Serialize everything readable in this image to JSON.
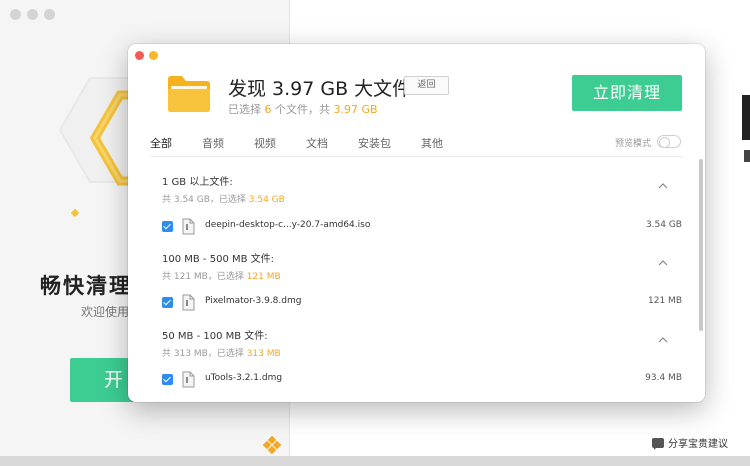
{
  "background": {
    "title": "畅快清理",
    "subtitle": "欢迎使用",
    "start_button": "开",
    "feedback": "分享宝贵建议"
  },
  "dialog": {
    "title": "发现 3.97 GB 大文件",
    "back_label": "返回",
    "summary": {
      "prefix": "已选择 ",
      "count": "6",
      "middle": " 个文件，共 ",
      "size": "3.97 GB"
    },
    "clean_label": "立即清理",
    "tabs": [
      {
        "label": "全部"
      },
      {
        "label": "音频"
      },
      {
        "label": "视频"
      },
      {
        "label": "文档"
      },
      {
        "label": "安装包"
      },
      {
        "label": "其他"
      }
    ],
    "preview_label": "预览模式",
    "preview_on": false,
    "groups": [
      {
        "title": "1 GB 以上文件:",
        "total_prefix": "共 3.54 GB，已选择 ",
        "selected": "3.54 GB",
        "file": {
          "name": "deepin-desktop-c...y-20.7-amd64.iso",
          "size": "3.54 GB",
          "checked": true
        }
      },
      {
        "title": "100 MB - 500 MB 文件:",
        "total_prefix": "共 121 MB，已选择 ",
        "selected": "121 MB",
        "file": {
          "name": "Pixelmator-3.9.8.dmg",
          "size": "121 MB",
          "checked": true
        }
      },
      {
        "title": "50 MB - 100 MB 文件:",
        "total_prefix": "共 313 MB，已选择 ",
        "selected": "313 MB",
        "file": {
          "name": "uTools-3.2.1.dmg",
          "size": "93.4 MB",
          "checked": true
        }
      }
    ]
  },
  "colors": {
    "accent": "#3dcd93",
    "highlight": "#f5a623",
    "checkbox": "#2d8cf0"
  }
}
